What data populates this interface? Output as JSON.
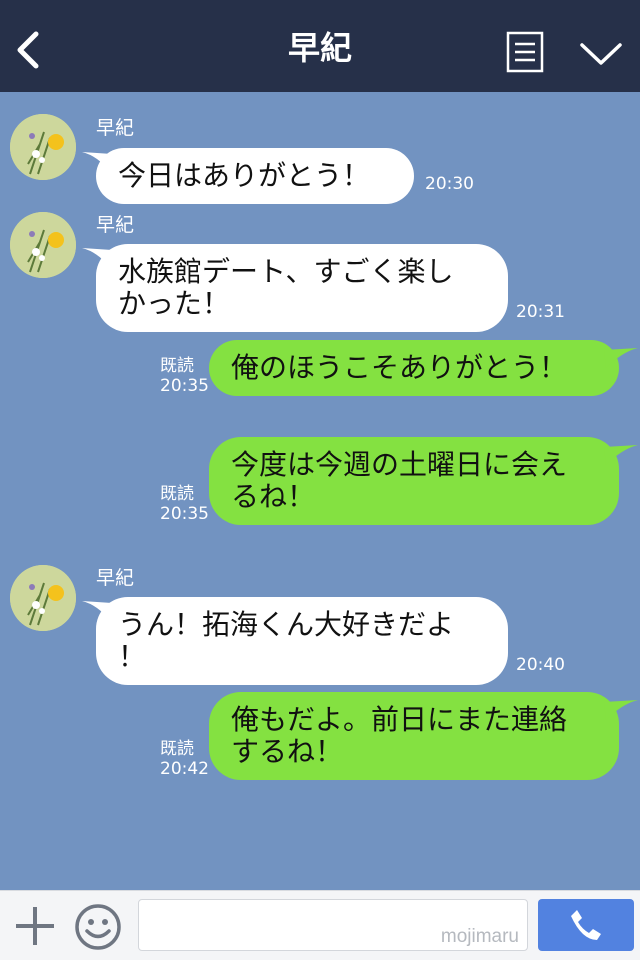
{
  "header": {
    "title": "早紀"
  },
  "messages": [
    {
      "sender": "早紀",
      "lines": [
        "今日はありがとう！"
      ],
      "time": "20:30"
    },
    {
      "sender": "早紀",
      "lines": [
        "水族館デート、すごく楽し",
        "かった！"
      ],
      "time": "20:31"
    },
    {
      "read": "既読",
      "time": "20:35",
      "lines": [
        "俺のほうこそありがとう！"
      ]
    },
    {
      "read": "既読",
      "time": "20:35",
      "lines": [
        "今度は今週の土曜日に会え",
        "るね！"
      ]
    },
    {
      "sender": "早紀",
      "lines": [
        "うん！拓海くん大好きだよ",
        "！"
      ],
      "time": "20:40"
    },
    {
      "read": "既読",
      "time": "20:42",
      "lines": [
        "俺もだよ。前日にまた連絡",
        "するね！"
      ]
    }
  ],
  "footer": {
    "watermark": "mojimaru"
  },
  "colors": {
    "header": "#263049",
    "background": "#7293c1",
    "incoming": "#ffffff",
    "outgoing": "#84e141",
    "call": "#5282e0"
  },
  "icons": [
    "back-icon",
    "menu-icon",
    "chevron-down-icon",
    "plus-icon",
    "smile-icon",
    "phone-icon"
  ]
}
